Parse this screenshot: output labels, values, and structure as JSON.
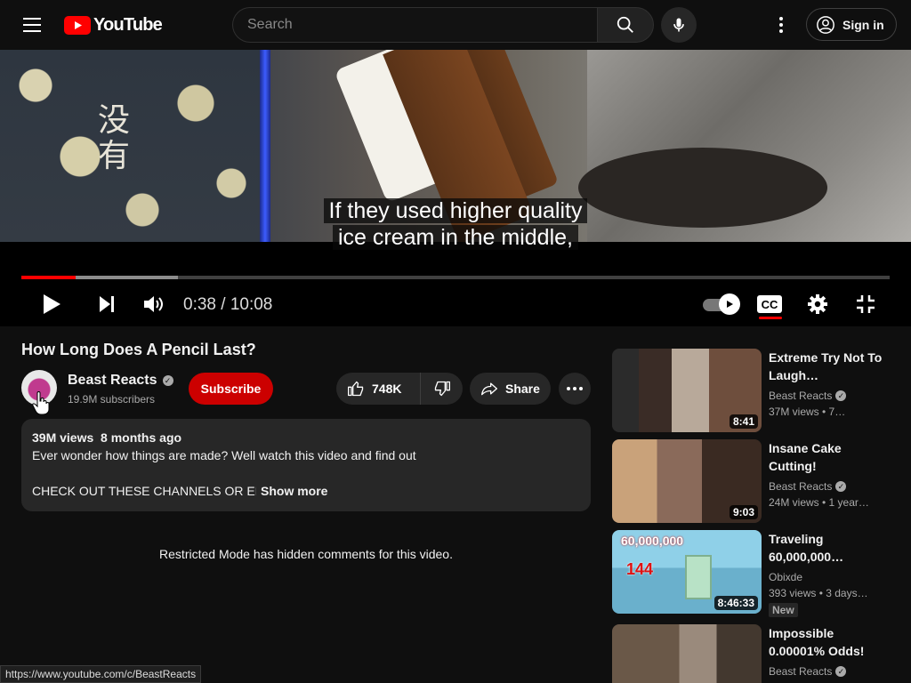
{
  "header": {
    "logo_text": "YouTube",
    "search_placeholder": "Search",
    "signin_label": "Sign in"
  },
  "player": {
    "caption_line1": "If they used higher quality",
    "caption_line2": "ice cream in the middle,",
    "current_time": "0:38",
    "duration": "10:08",
    "time_display": "0:38 / 10:08",
    "frame_text": "没有",
    "played_fraction": 0.063,
    "buffered_fraction": 0.18,
    "cc_label": "CC",
    "accent_color": "#ff0000"
  },
  "video": {
    "title": "How Long Does A Pencil Last?",
    "channel_name": "Beast Reacts",
    "subscribers": "19.9M subscribers",
    "subscribe_label": "Subscribe",
    "likes": "748K",
    "share_label": "Share",
    "views": "39M views",
    "uploaded": "8 months ago",
    "description_line1": "Ever wonder how things are made? Well watch this video and find out",
    "description_line2": "CHECK OUT THESE CHANNELS OR ELSE",
    "show_more": "Show more",
    "restricted_notice": "Restricted Mode has hidden comments for this video."
  },
  "status_url": "https://www.youtube.com/c/BeastReacts",
  "recommendations": [
    {
      "title": "Extreme Try Not To Laugh…",
      "channel": "Beast Reacts",
      "verified": true,
      "meta": "37M views • 7…",
      "duration": "8:41",
      "badge": ""
    },
    {
      "title": "Insane Cake Cutting!",
      "channel": "Beast Reacts",
      "verified": true,
      "meta": "24M views • 1 year…",
      "duration": "9:03",
      "badge": ""
    },
    {
      "title": "Traveling 60,000,000…",
      "channel": "Obixde",
      "verified": false,
      "meta": "393 views • 3 days…",
      "duration": "8:46:33",
      "badge": "New",
      "thumb_text_top": "60,000,000",
      "thumb_text_mid": "144"
    },
    {
      "title": "Impossible 0.00001% Odds!",
      "channel": "Beast Reacts",
      "verified": true,
      "meta": "",
      "duration": "",
      "badge": ""
    }
  ]
}
